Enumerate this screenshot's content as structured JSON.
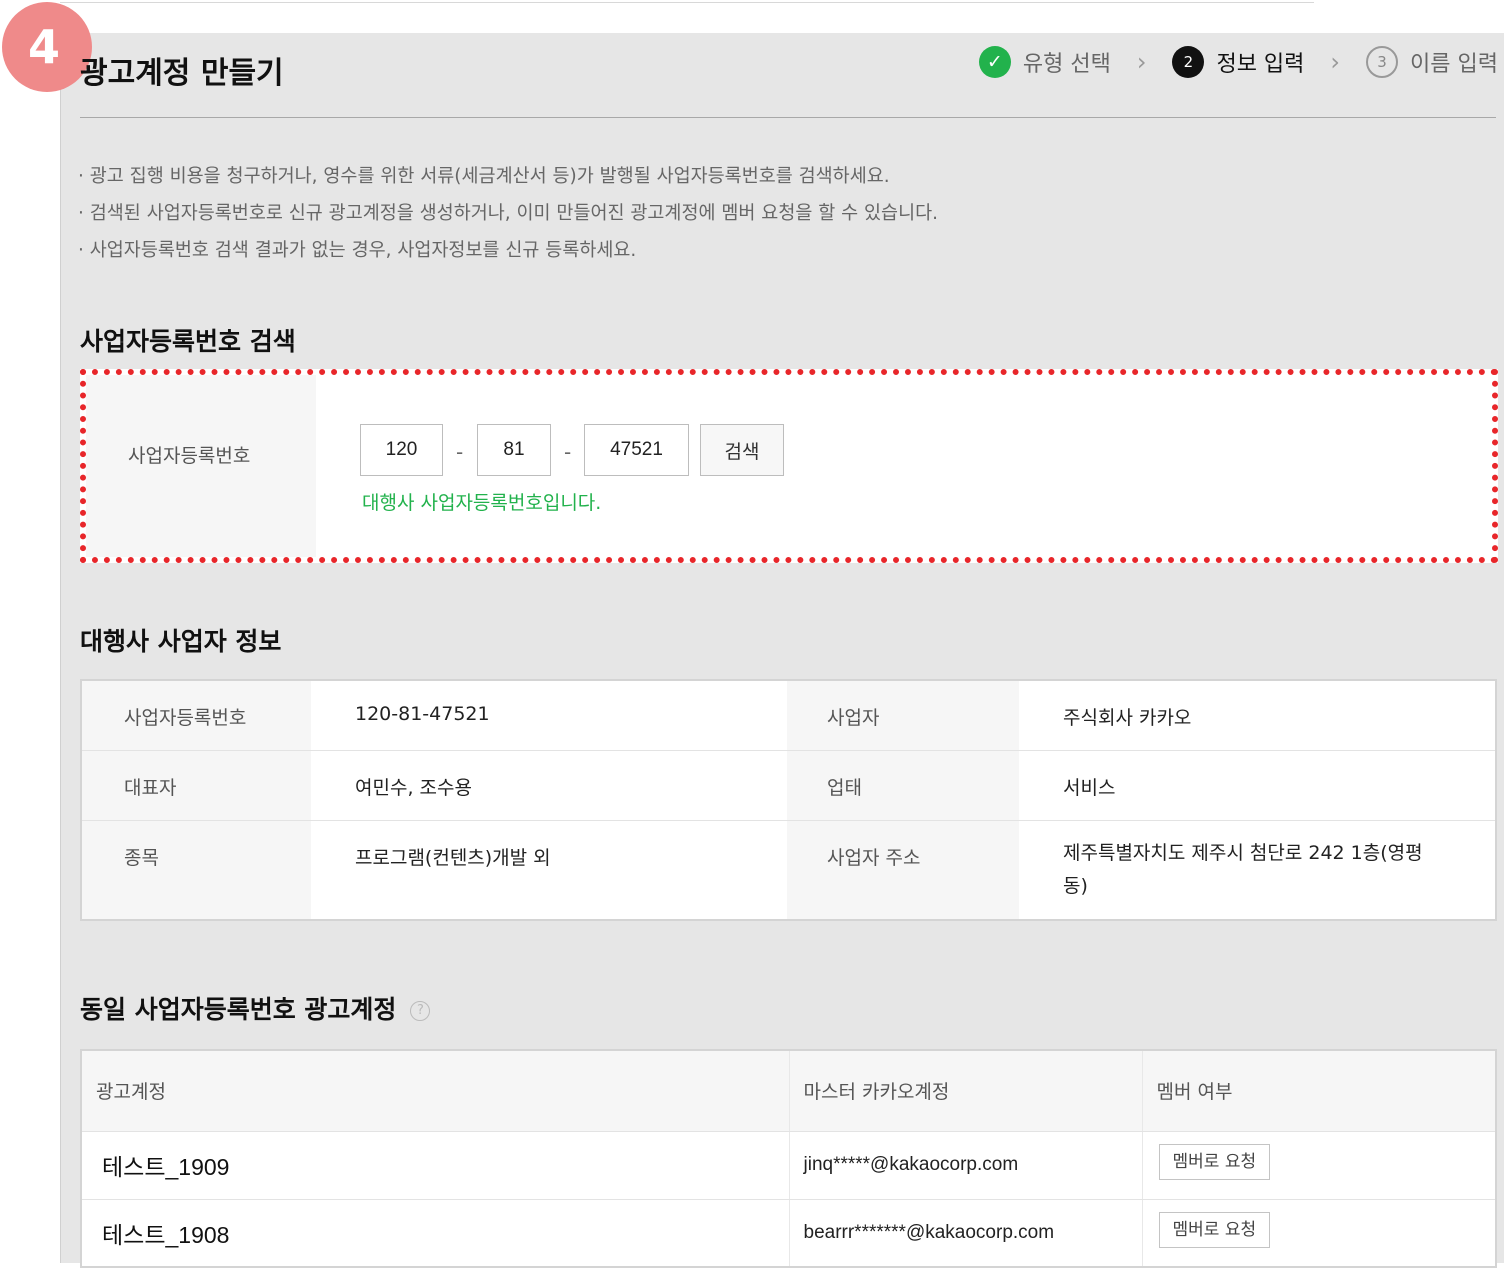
{
  "step_badge": "4",
  "page_title": "광고계정 만들기",
  "steps": [
    {
      "icon": "✓",
      "label": "유형 선택",
      "state": "done"
    },
    {
      "icon": "2",
      "label": "정보 입력",
      "state": "current"
    },
    {
      "icon": "3",
      "label": "이름 입력",
      "state": "todo"
    }
  ],
  "notes": [
    "광고 집행 비용을 청구하거나, 영수를 위한 서류(세금계산서 등)가 발행될 사업자등록번호를 검색하세요.",
    "검색된 사업자등록번호로 신규 광고계정을 생성하거나, 이미 만들어진 광고계정에 멤버 요청을 할 수 있습니다.",
    "사업자등록번호 검색 결과가 없는 경우, 사업자정보를 신규 등록하세요."
  ],
  "search_section": {
    "heading": "사업자등록번호 검색",
    "label": "사업자등록번호",
    "part1": "120",
    "part2": "81",
    "part3": "47521",
    "separator": "-",
    "button": "검색",
    "message": "대행사 사업자등록번호입니다."
  },
  "agency_section": {
    "heading": "대행사 사업자 정보",
    "rows": [
      {
        "label1": "사업자등록번호",
        "value1": "120-81-47521",
        "label2": "사업자",
        "value2": "주식회사 카카오"
      },
      {
        "label1": "대표자",
        "value1": "여민수, 조수용",
        "label2": "업태",
        "value2": "서비스"
      },
      {
        "label1": "종목",
        "value1": "프로그램(컨텐츠)개발 외",
        "label2": "사업자 주소",
        "value2": "제주특별자치도 제주시 첨단로 242 1층(영평동)"
      }
    ]
  },
  "accounts_section": {
    "heading": "동일 사업자등록번호 광고계정",
    "help_icon": "?",
    "columns": [
      "광고계정",
      "마스터 카카오계정",
      "멤버 여부"
    ],
    "rows": [
      {
        "account": "테스트_1909",
        "master": "jinq*****@kakaocorp.com",
        "action": "멤버로 요청"
      },
      {
        "account": "테스트_1908",
        "master": "bearrr*******@kakaocorp.com",
        "action": "멤버로 요청"
      }
    ]
  },
  "colors": {
    "highlight_border": "#e8262a",
    "success": "#22b24c",
    "badge": "#ef8a8a"
  }
}
